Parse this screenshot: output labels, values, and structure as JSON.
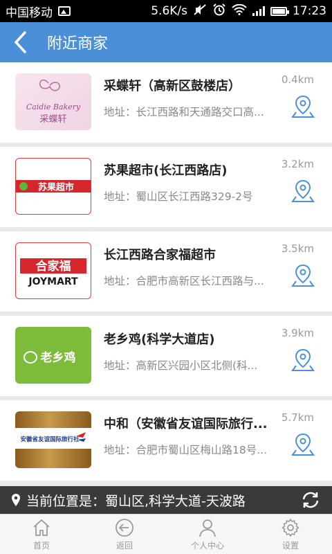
{
  "status": {
    "carrier": "中国移动",
    "speed": "5.6K/s",
    "time": "17:23"
  },
  "header": {
    "title": "附近商家"
  },
  "merchants": [
    {
      "name": "采蝶轩（高新区鼓楼店）",
      "address": "地址：长江西路和天通路交口高...",
      "distance": "0.4km",
      "logo_text": "Caidie Bakery",
      "logo_sub": "采蝶轩"
    },
    {
      "name": "苏果超市(长江西路店)",
      "address": "地址：蜀山区长江西路329-2号",
      "distance": "3.2km",
      "logo_text": "苏果超市"
    },
    {
      "name": "长江西路合家福超市",
      "address": "地址：合肥市高新区长江西路与...",
      "distance": "3.5km",
      "logo_text": "合家福",
      "logo_sub": "JOYMART"
    },
    {
      "name": "老乡鸡(科学大道店)",
      "address": "地址：高新区兴园小区北侧(科...",
      "distance": "3.9km",
      "logo_text": "老乡鸡"
    },
    {
      "name": "中和（安徽省友谊国际旅行...",
      "address": "地址：合肥市蜀山区梅山路18号...",
      "distance": "5.7km",
      "logo_text": "安徽省友谊国际旅行社"
    }
  ],
  "location": {
    "text": "当前位置是：蜀山区,科学大道-天波路"
  },
  "tabs": [
    {
      "label": "首页",
      "icon": "home-icon"
    },
    {
      "label": "返回",
      "icon": "back-circle-icon"
    },
    {
      "label": "个人中心",
      "icon": "user-icon"
    },
    {
      "label": "设置",
      "icon": "gear-icon"
    }
  ],
  "colors": {
    "accent": "#4a90d9",
    "location_bar": "#3a3a3a"
  }
}
